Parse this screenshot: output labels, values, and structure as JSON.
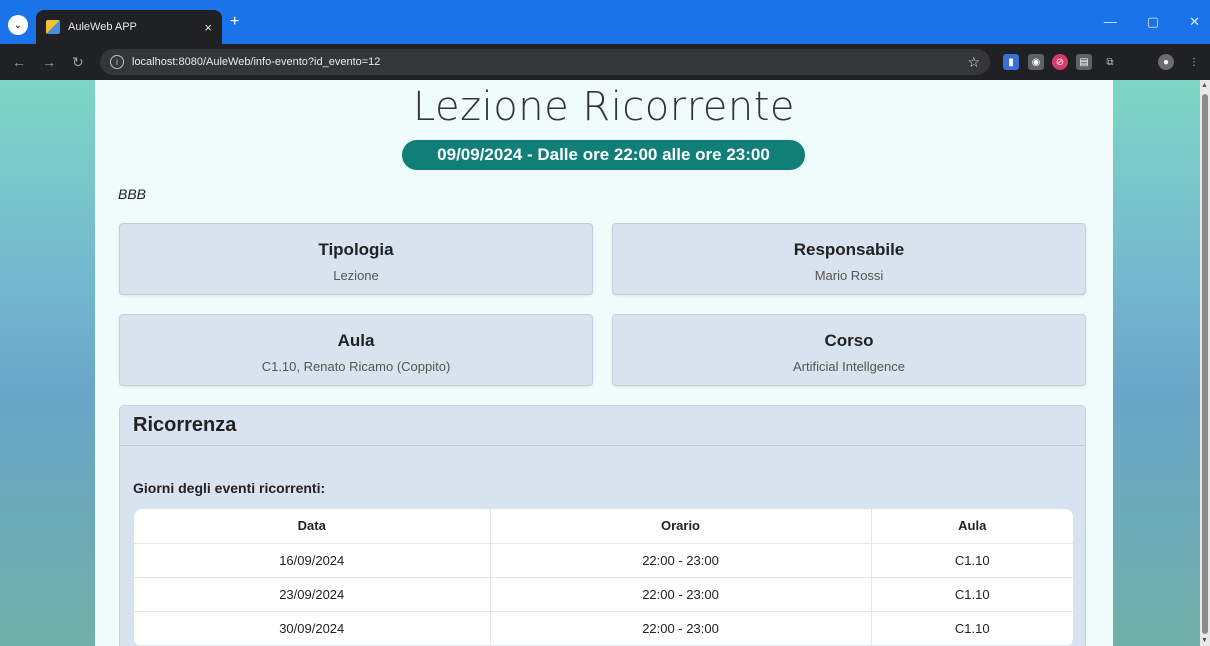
{
  "browser": {
    "tab_title": "AuleWeb APP",
    "tab_close": "×",
    "new_tab": "+",
    "url": "localhost:8080/AuleWeb/info-evento?id_evento=12"
  },
  "page": {
    "title": "Lezione Ricorrente",
    "date_range": "09/09/2024 - Dalle ore 22:00 alle ore 23:00",
    "description": "BBB"
  },
  "info_cards": [
    {
      "heading": "Tipologia",
      "value": "Lezione"
    },
    {
      "heading": "Responsabile",
      "value": "Mario Rossi"
    },
    {
      "heading": "Aula",
      "value": "C1.10, Renato Ricamo (Coppito)"
    },
    {
      "heading": "Corso",
      "value": "Artificial Intellgence"
    }
  ],
  "recurrence": {
    "heading": "Ricorrenza",
    "subheading": "Giorni degli eventi ricorrenti:",
    "columns": [
      "Data",
      "Orario",
      "Aula"
    ],
    "rows": [
      [
        "16/09/2024",
        "22:00 - 23:00",
        "C1.10"
      ],
      [
        "23/09/2024",
        "22:00 - 23:00",
        "C1.10"
      ],
      [
        "30/09/2024",
        "22:00 - 23:00",
        "C1.10"
      ]
    ]
  },
  "colors": {
    "accent": "#0f7f78",
    "card_bg": "#d8e3ef",
    "tab_bar": "#1a73e8"
  }
}
